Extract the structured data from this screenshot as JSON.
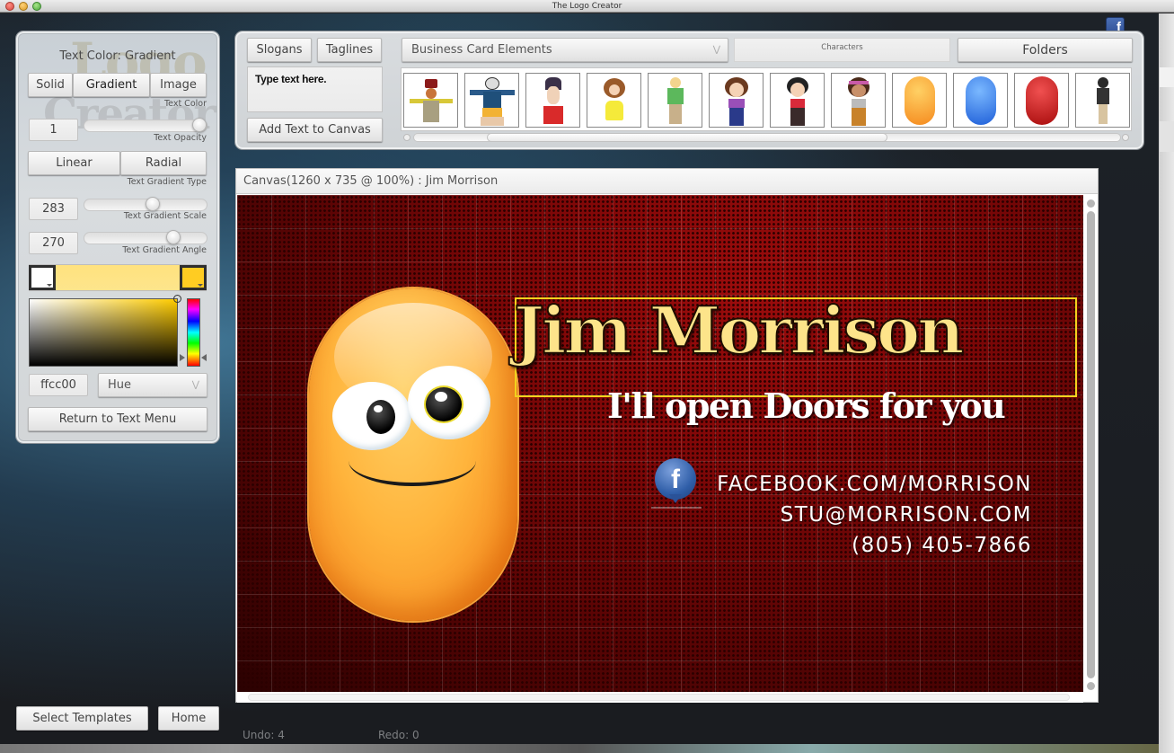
{
  "window": {
    "title": "The Logo Creator"
  },
  "left_panel": {
    "title": "Text Color: Gradient",
    "color_modes": [
      "Solid",
      "Gradient",
      "Image"
    ],
    "active_color_mode": "Gradient",
    "text_color_label": "Text Color",
    "opacity_value": "1",
    "opacity_label": "Text Opacity",
    "opacity_level": 1.0,
    "gradient_types": [
      "Linear",
      "Radial"
    ],
    "gradient_type_label": "Text Gradient Type",
    "scale_value": "283",
    "scale_label": "Text Gradient Scale",
    "angle_value": "270",
    "angle_label": "Text Gradient Angle",
    "gradient_start_color": "#ffffff",
    "gradient_end_color": "#ffcc22",
    "hex_value": "ffcc00",
    "picker_mode": "Hue",
    "return_button": "Return to Text Menu"
  },
  "top_panel": {
    "slogans_button": "Slogans",
    "taglines_button": "Taglines",
    "text_input_placeholder": "Type text here.",
    "add_text_button": "Add Text to Canvas",
    "category_dropdown": "Business Card Elements",
    "section_label": "Characters",
    "folders_button": "Folders",
    "thumbnails": [
      {
        "name": "farmer-character"
      },
      {
        "name": "tourist-character"
      },
      {
        "name": "spiky-hair-character"
      },
      {
        "name": "girl-yellow-dress-character"
      },
      {
        "name": "blonde-boy-character"
      },
      {
        "name": "brunette-girl-character"
      },
      {
        "name": "punk-girl-character"
      },
      {
        "name": "headband-girl-character"
      },
      {
        "name": "orange-bean-character"
      },
      {
        "name": "blue-bean-character"
      },
      {
        "name": "red-bean-character"
      },
      {
        "name": "dark-hair-boy-character"
      }
    ]
  },
  "canvas": {
    "header": "Canvas(1260 x 735 @ 100%) : Jim Morrison",
    "name_text": "Jim Morrison",
    "tagline_text": "I'll open Doors for you",
    "facebook_text": "FACEBOOK.COM/MORRISON",
    "email_text": "STU@MORRISON.COM",
    "phone_text": "(805) 405-7866",
    "fb_glyph": "f"
  },
  "bottom": {
    "select_templates_button": "Select Templates",
    "home_button": "Home",
    "undo_status": "Undo: 4",
    "redo_status": "Redo: 0"
  },
  "colors": {
    "name_fill": "#fde48a",
    "canvas_bg": "#7a0707",
    "selection_border": "#f2d21d"
  }
}
